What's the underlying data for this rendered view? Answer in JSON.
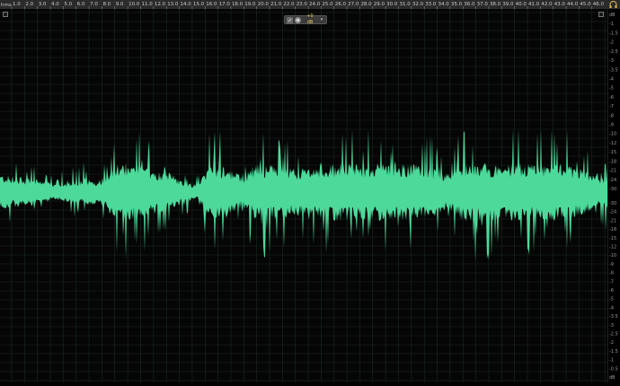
{
  "timeline": {
    "unit_label": "hms",
    "ticks": [
      "1.0",
      "2.0",
      "3.0",
      "4.0",
      "5.0",
      "6.0",
      "7.0",
      "8.0",
      "9.0",
      "10.0",
      "11.0",
      "12.0",
      "13.0",
      "14.0",
      "15.0",
      "16.0",
      "17.0",
      "18.0",
      "19.0",
      "20.0",
      "21.0",
      "22.0",
      "23.0",
      "24.0",
      "25.0",
      "26.0",
      "27.0",
      "28.0",
      "29.0",
      "30.0",
      "31.0",
      "32.0",
      "33.0",
      "34.0",
      "35.0",
      "36.0",
      "37.0",
      "38.0",
      "39.0",
      "40.0",
      "41.0",
      "42.0",
      "43.0",
      "44.0",
      "45.0",
      "46.0"
    ]
  },
  "db_scale": {
    "top_labels": [
      "dB",
      "-1",
      "-1.5",
      "-2",
      "-2.5",
      "-3",
      "-3.5",
      "-4",
      "-5",
      "-6",
      "-7",
      "-8",
      "-9",
      "-10",
      "-12",
      "-15",
      "-18",
      "-21",
      "-24",
      "-30"
    ],
    "bottom_labels": [
      "-30",
      "-24",
      "-21",
      "-18",
      "-15",
      "-12",
      "-10",
      "-9",
      "-8",
      "-7",
      "-6",
      "-5",
      "-4",
      "-3.5",
      "-3",
      "-2.5",
      "-2",
      "-1.5",
      "-1",
      "-0.5",
      "dB"
    ]
  },
  "hud": {
    "gain_label": "+0 dB"
  },
  "colors": {
    "waveform": "#4dd99a",
    "background": "#000000",
    "grid": "#1b2a22",
    "ruler_bg": "#2b2b2b",
    "hud_text": "#e6c95a"
  },
  "icons": {
    "headphones": "headphones-icon",
    "gain_knob": "knob-icon",
    "hud_pin": "pin-icon",
    "dropdown": "chevron-down-icon"
  }
}
